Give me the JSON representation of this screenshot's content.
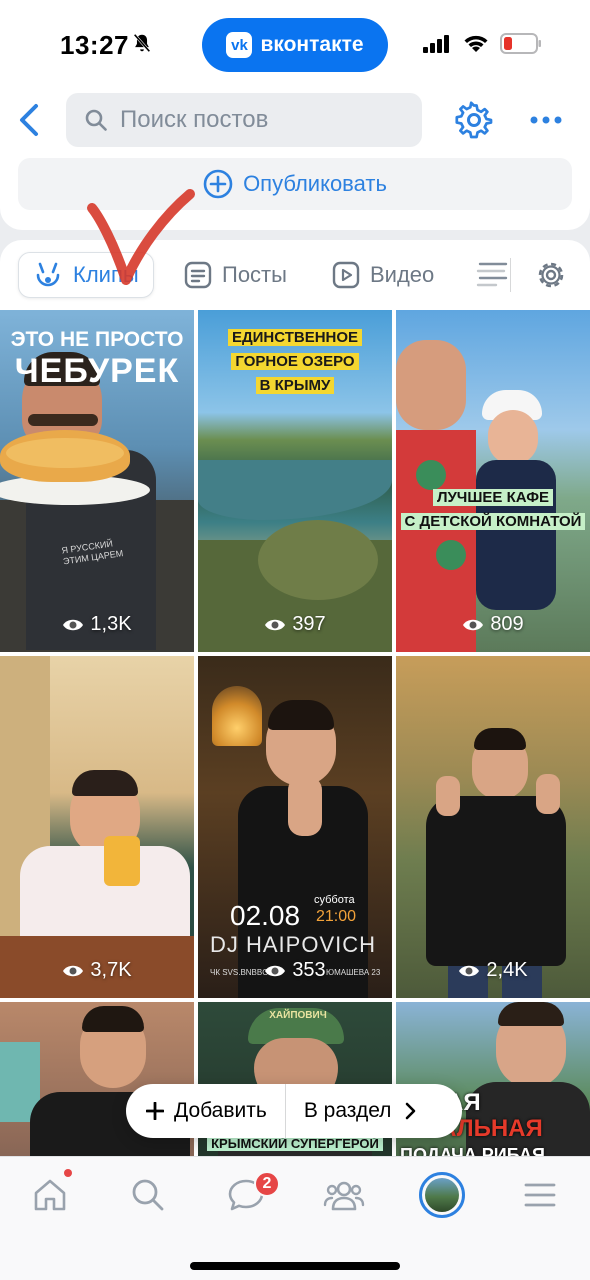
{
  "status_bar": {
    "time": "13:27",
    "vk_pill_label": "вконтакте",
    "vk_logo": "vk"
  },
  "header": {
    "search_placeholder": "Поиск постов"
  },
  "publish": {
    "label": "Опубликовать"
  },
  "tabs": [
    {
      "label": "Клипы",
      "icon": "clip-icon",
      "active": true
    },
    {
      "label": "Посты",
      "icon": "posts-icon",
      "active": false
    },
    {
      "label": "Видео",
      "icon": "video-icon",
      "active": false
    }
  ],
  "clips": [
    {
      "views": "1,3K",
      "caption_lines": [
        "ЭТО НЕ ПРОСТО",
        "ЧЕБУРЕК"
      ],
      "shirt_text": "Я РУССКИЙ ЭТИМ ЦАРЕМ"
    },
    {
      "views": "397",
      "caption_lines": [
        "ЕДИНСТВЕННОЕ",
        "ГОРНОЕ ОЗЕРО",
        "В КРЫМУ"
      ]
    },
    {
      "views": "809",
      "caption_lines": [
        "ЛУЧШЕЕ КАФЕ",
        "С ДЕТСКОЙ КОМНАТОЙ"
      ]
    },
    {
      "views": "3,7K"
    },
    {
      "views": "353",
      "event_date": "02.08",
      "event_day": "суббота",
      "event_time": "21:00",
      "event_name": "DJ HAIPOVICH",
      "event_footer_left": "ЧК SVS.BNBBOYS",
      "event_footer_right": "ЮМАШЕВА 23"
    },
    {
      "views": "2,4K"
    },
    {
      "views": ""
    },
    {
      "views": "",
      "caption_lines": [
        "КРЫМСКИЙ СУПЕРГЕРОЙ"
      ],
      "cap_text": "ХАЙПОВИЧ"
    },
    {
      "views": "",
      "caption_lines": [
        "АЯ",
        "УАЛЬНАЯ",
        "ПОДАЧА РИБАЯ"
      ]
    }
  ],
  "action_pill": {
    "add_label": "Добавить",
    "section_label": "В раздел"
  },
  "tab_bar": {
    "messages_badge": "2"
  },
  "colors": {
    "accent": "#2d81e0",
    "vk_blue": "#0a74f0",
    "badge_red": "#e64646"
  }
}
